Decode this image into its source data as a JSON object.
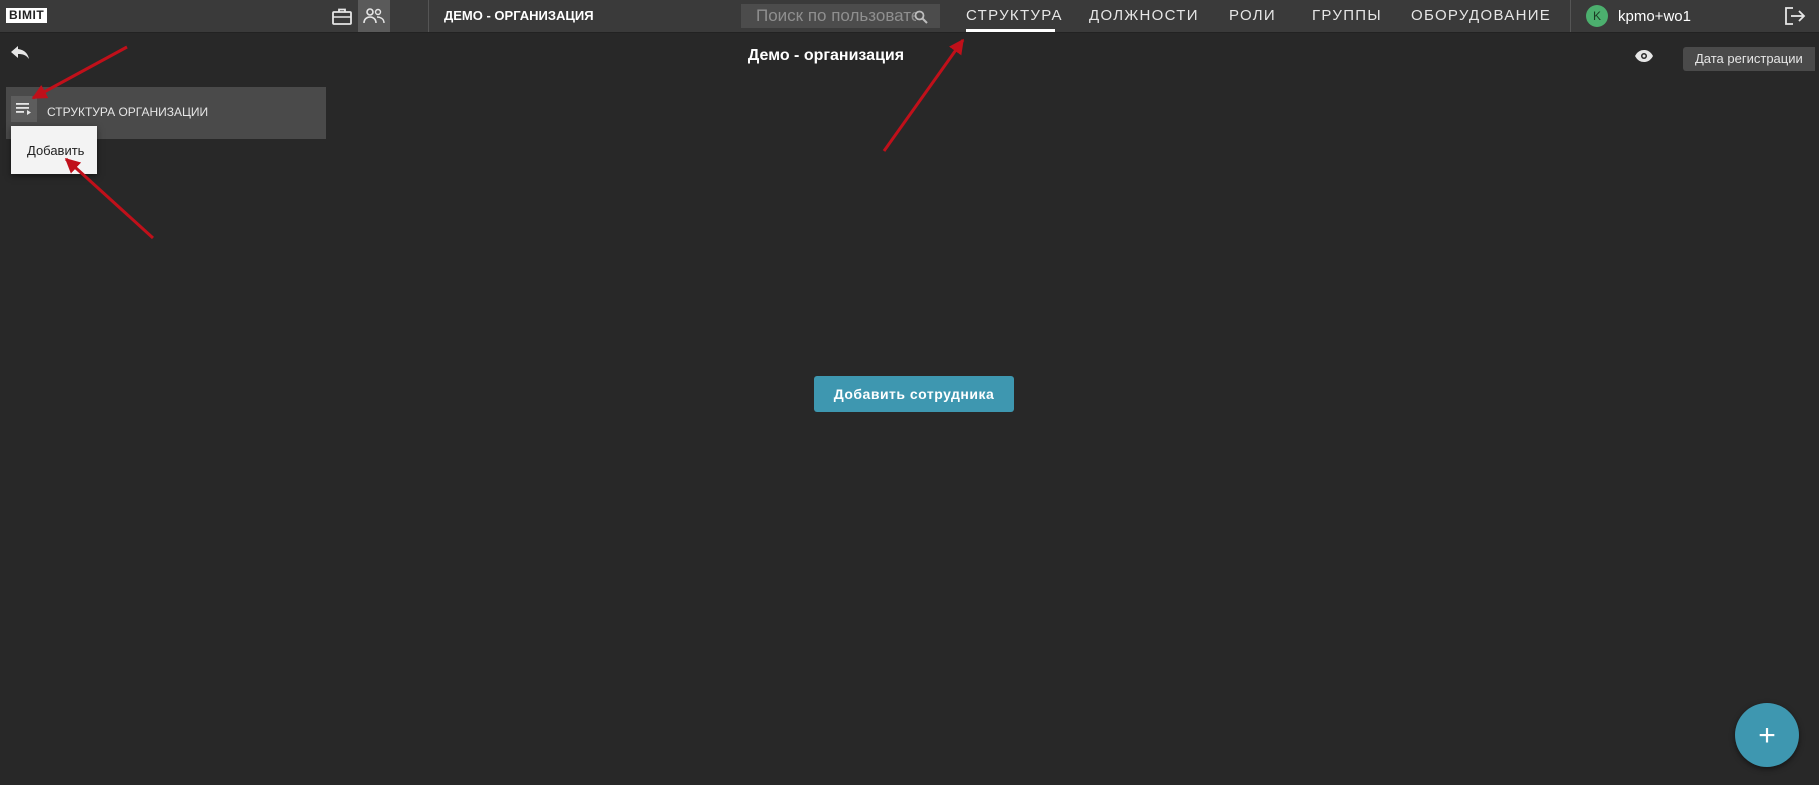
{
  "app": {
    "logo": "BIMIT",
    "org_name": "ДЕМО - ОРГАНИЗАЦИЯ"
  },
  "icons": {
    "briefcase": "briefcase-icon",
    "people": "people-icon",
    "search": "search-icon",
    "logout": "logout-icon",
    "back": "back-arrow-icon",
    "eye": "eye-icon",
    "menu": "menu-list-icon",
    "plus": "plus-icon"
  },
  "search": {
    "placeholder": "Поиск по пользователям"
  },
  "nav": {
    "tabs": [
      {
        "label": "СТРУКТУРА",
        "active": true
      },
      {
        "label": "ДОЛЖНОСТИ",
        "active": false
      },
      {
        "label": "РОЛИ",
        "active": false
      },
      {
        "label": "ГРУППЫ",
        "active": false
      },
      {
        "label": "ОБОРУДОВАНИЕ",
        "active": false
      }
    ]
  },
  "user": {
    "initial": "K",
    "name": "kpmo+wo1"
  },
  "page": {
    "title": "Демо - организация",
    "reg_date_label": "Дата регистрации"
  },
  "structure": {
    "title": "СТРУКТУРА ОРГАНИЗАЦИИ",
    "menu_items": [
      {
        "label": "Добавить"
      }
    ]
  },
  "main": {
    "add_employee_label": "Добавить сотрудника",
    "fab_label": "+"
  },
  "colors": {
    "accent": "#3e97b0",
    "background": "#282828",
    "topbar": "#3a3a3a",
    "avatar": "#4caf6e",
    "annotation": "#c0101a"
  }
}
